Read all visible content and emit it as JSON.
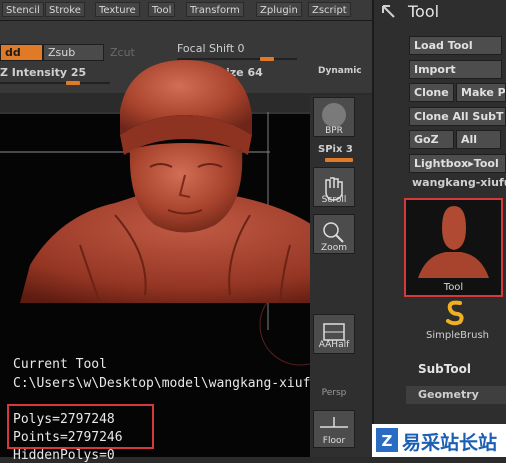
{
  "menubar": {
    "items": [
      "Stencil",
      "Stroke",
      "Texture",
      "Tool",
      "Transform",
      "Zplugin",
      "Zscript"
    ]
  },
  "shelf": {
    "zadd_label": "dd",
    "zsub_label": "Zsub",
    "zcut_label": "Zcut",
    "focal_shift": "Focal Shift 0",
    "z_intensity": "Z Intensity 25",
    "draw_size": "ize 64",
    "dynamic": "Dynamic"
  },
  "right_shelf": {
    "bpr": "BPR",
    "spix": "SPix 3",
    "scroll": "Scroll",
    "zoom": "Zoom",
    "actual": "Actual",
    "aahalf": "AAHalf",
    "persp": "Persp",
    "floor": "Floor"
  },
  "canvas": {
    "current_tool_label": "Current Tool",
    "path": "C:\\Users\\w\\Desktop\\model\\wangkang-xiufu",
    "polys": "Polys=2797248",
    "points": "Points=2797246",
    "hidden_polys": "HiddenPolys=0"
  },
  "tool_panel": {
    "title": "Tool",
    "load_tool": "Load Tool",
    "import": "Import",
    "clone": "Clone",
    "make_poly": "Make P",
    "clone_all_subtools": "Clone All SubT",
    "goz": "GoZ",
    "all": "All",
    "lightbox_tools": "Lightbox▸Tool",
    "current_tool_name": "wangkang-xiufu",
    "thumb_label": "Tool",
    "simplebrush": "SimpleBrush",
    "subtool": "SubTool",
    "geometry": "Geometry"
  },
  "watermark": {
    "cn_text": "易采站长站"
  },
  "colors": {
    "accent": "#e07a26",
    "highlight": "#d43a3a",
    "model": "#b0452f"
  }
}
